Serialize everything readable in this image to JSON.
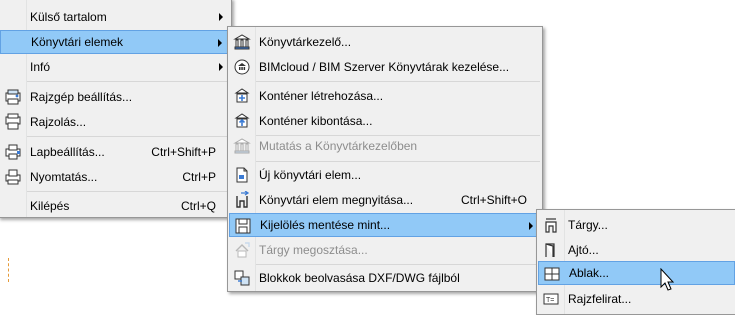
{
  "menu_main": {
    "items": [
      {
        "label": "Külső tartalom"
      },
      {
        "label": "Könyvtári elemek"
      },
      {
        "label": "Infó"
      },
      {
        "label": "Rajzgép beállítás..."
      },
      {
        "label": "Rajzolás..."
      },
      {
        "label": "Lapbeállítás...",
        "shortcut": "Ctrl+Shift+P"
      },
      {
        "label": "Nyomtatás...",
        "shortcut": "Ctrl+P"
      },
      {
        "label": "Kilépés",
        "shortcut": "Ctrl+Q"
      }
    ]
  },
  "menu_library": {
    "items": [
      {
        "label": "Könyvtárkezelő..."
      },
      {
        "label": "BIMcloud / BIM Szerver Könyvtárak kezelése..."
      },
      {
        "label": "Konténer létrehozása..."
      },
      {
        "label": "Konténer kibontása..."
      },
      {
        "label": "Mutatás a Könyvtárkezelőben"
      },
      {
        "label": "Új könyvtári elem..."
      },
      {
        "label": "Könyvtári elem megnyitása...",
        "shortcut": "Ctrl+Shift+O"
      },
      {
        "label": "Kijelölés mentése mint..."
      },
      {
        "label": "Tárgy megosztása..."
      },
      {
        "label": "Blokkok beolvasása DXF/DWG fájlból"
      }
    ]
  },
  "menu_save": {
    "items": [
      {
        "label": "Tárgy..."
      },
      {
        "label": "Ajtó..."
      },
      {
        "label": "Ablak..."
      },
      {
        "label": "Rajzfelirat..."
      }
    ]
  },
  "colors": {
    "highlight": "#91c9f7",
    "highlight_border": "#62a2e4",
    "menu_bg": "#f0f0f0",
    "disabled_text": "#8d8d8d"
  }
}
